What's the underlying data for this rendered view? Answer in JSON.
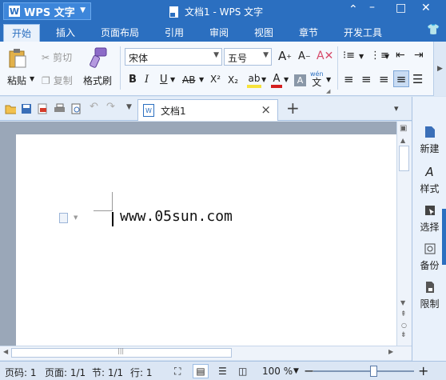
{
  "app": {
    "name": "WPS 文字",
    "window_title": "文档1 - WPS 文字"
  },
  "menu": [
    "开始",
    "插入",
    "页面布局",
    "引用",
    "审阅",
    "视图",
    "章节",
    "开发工具"
  ],
  "ribbon": {
    "paste": "粘贴",
    "cut": "剪切",
    "copy": "复制",
    "format_painter": "格式刷",
    "font_name": "宋体",
    "font_size": "五号",
    "bold": "B",
    "italic": "I",
    "underline": "U",
    "strike": "AB",
    "superscript": "X²",
    "subscript": "X₂",
    "font_color": "A",
    "char_shade": "A",
    "phonetic_top": "wén",
    "phonetic_bottom": "文"
  },
  "tab": {
    "doc_name": "文档1",
    "close": "×",
    "add": "+"
  },
  "document": {
    "text": "www.05sun.com"
  },
  "right_panel": [
    "新建",
    "样式",
    "选择",
    "备份",
    "限制"
  ],
  "status": {
    "page": "页码: 1",
    "pages": "页面: 1/1",
    "section": "节: 1/1",
    "line": "行: 1",
    "zoom": "100 %",
    "zoom_minus": "−",
    "zoom_plus": "+",
    "zoom_level": 0.6
  },
  "colors": {
    "brand": "#2b6fc0",
    "highlight": "#f7e33b",
    "font_color": "#d42020"
  }
}
